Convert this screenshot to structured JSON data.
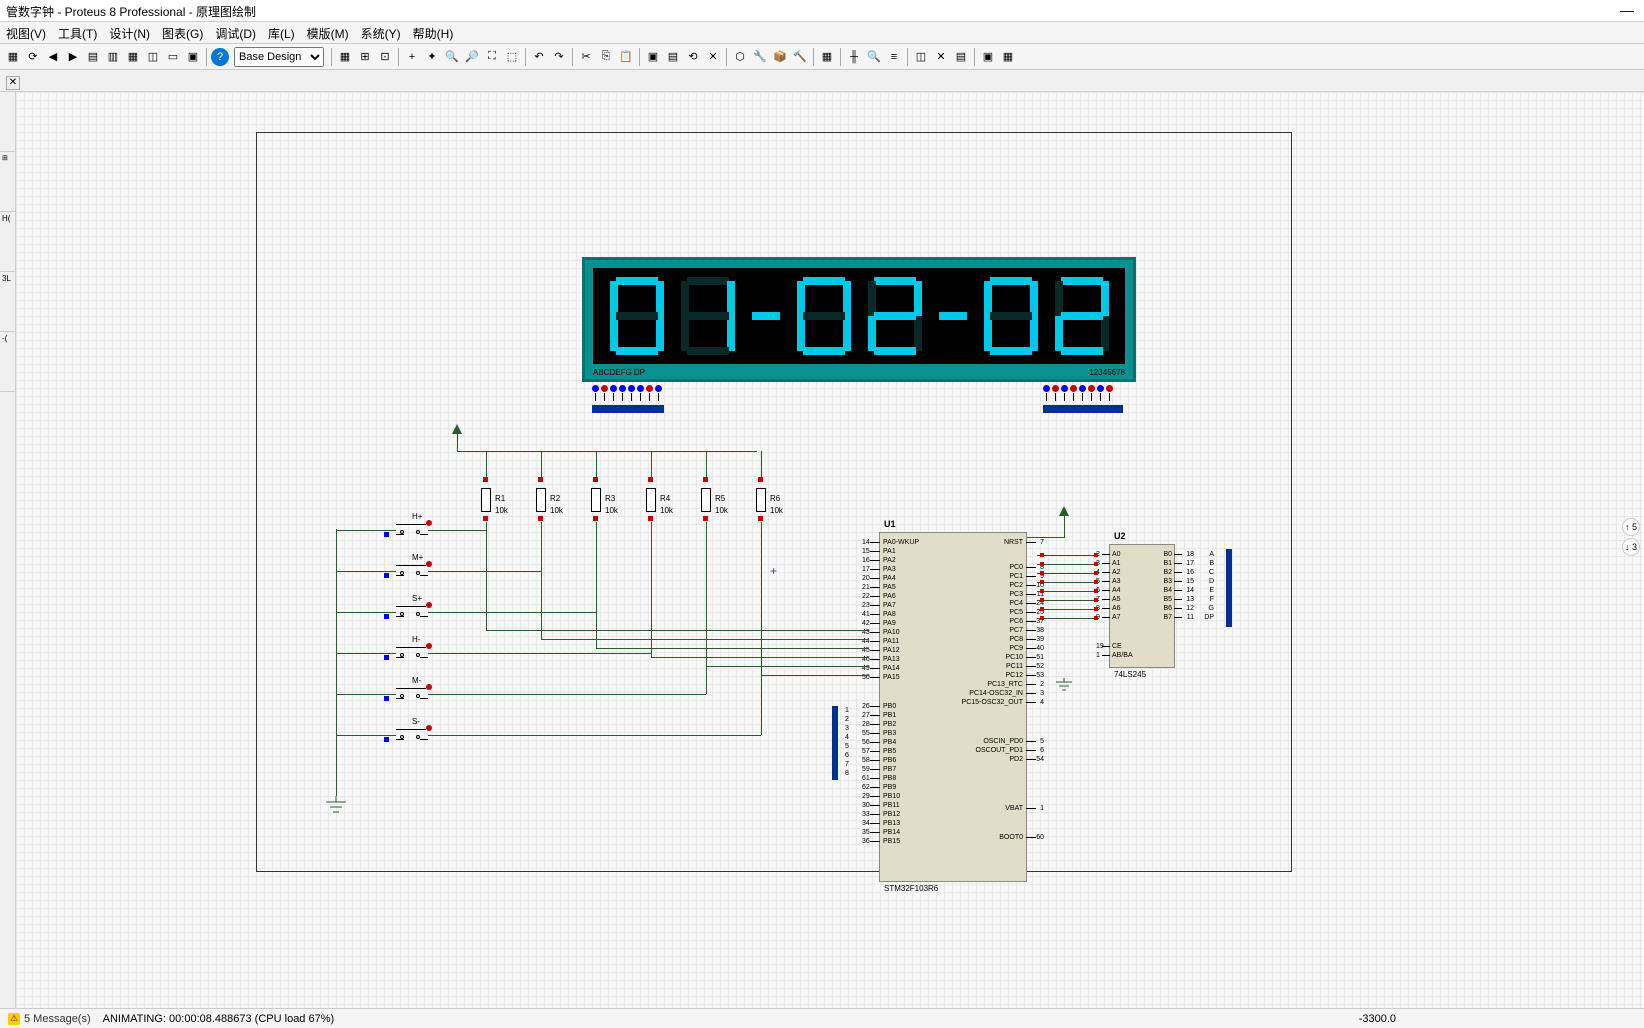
{
  "window": {
    "title": "管数字钟 - Proteus 8 Professional - 原理图绘制"
  },
  "menu": {
    "items": [
      "视图(V)",
      "工具(T)",
      "设计(N)",
      "图表(G)",
      "调试(D)",
      "库(L)",
      "模版(M)",
      "系统(Y)",
      "帮助(H)"
    ]
  },
  "toolbar": {
    "design_select": "Base Design"
  },
  "schematic": {
    "display": {
      "digits": [
        "0",
        "1",
        "-",
        "0",
        "2",
        "-",
        "0",
        "2"
      ],
      "pin_label_left": "ABCDEFG DP",
      "pin_label_right": "12345678"
    },
    "chips": {
      "u1": {
        "name": "U1",
        "part": "STM32F103R6",
        "left_pins": [
          {
            "num": "14",
            "lbl": "PA0-WKUP"
          },
          {
            "num": "15",
            "lbl": "PA1"
          },
          {
            "num": "16",
            "lbl": "PA2"
          },
          {
            "num": "17",
            "lbl": "PA3"
          },
          {
            "num": "20",
            "lbl": "PA4"
          },
          {
            "num": "21",
            "lbl": "PA5"
          },
          {
            "num": "22",
            "lbl": "PA6"
          },
          {
            "num": "23",
            "lbl": "PA7"
          },
          {
            "num": "41",
            "lbl": "PA8"
          },
          {
            "num": "42",
            "lbl": "PA9"
          },
          {
            "num": "43",
            "lbl": "PA10"
          },
          {
            "num": "44",
            "lbl": "PA11"
          },
          {
            "num": "45",
            "lbl": "PA12"
          },
          {
            "num": "46",
            "lbl": "PA13"
          },
          {
            "num": "49",
            "lbl": "PA14"
          },
          {
            "num": "50",
            "lbl": "PA15"
          },
          {
            "num": "26",
            "lbl": "PB0"
          },
          {
            "num": "27",
            "lbl": "PB1"
          },
          {
            "num": "28",
            "lbl": "PB2"
          },
          {
            "num": "55",
            "lbl": "PB3"
          },
          {
            "num": "56",
            "lbl": "PB4"
          },
          {
            "num": "57",
            "lbl": "PB5"
          },
          {
            "num": "58",
            "lbl": "PB6"
          },
          {
            "num": "59",
            "lbl": "PB7"
          },
          {
            "num": "61",
            "lbl": "PB8"
          },
          {
            "num": "62",
            "lbl": "PB9"
          },
          {
            "num": "29",
            "lbl": "PB10"
          },
          {
            "num": "30",
            "lbl": "PB11"
          },
          {
            "num": "33",
            "lbl": "PB12"
          },
          {
            "num": "34",
            "lbl": "PB13"
          },
          {
            "num": "35",
            "lbl": "PB14"
          },
          {
            "num": "36",
            "lbl": "PB15"
          }
        ],
        "right_pins": [
          {
            "num": "7",
            "lbl": "NRST"
          },
          {
            "num": "8",
            "lbl": "PC0"
          },
          {
            "num": "9",
            "lbl": "PC1"
          },
          {
            "num": "10",
            "lbl": "PC2"
          },
          {
            "num": "11",
            "lbl": "PC3"
          },
          {
            "num": "24",
            "lbl": "PC4"
          },
          {
            "num": "25",
            "lbl": "PC5"
          },
          {
            "num": "37",
            "lbl": "PC6"
          },
          {
            "num": "38",
            "lbl": "PC7"
          },
          {
            "num": "39",
            "lbl": "PC8"
          },
          {
            "num": "40",
            "lbl": "PC9"
          },
          {
            "num": "51",
            "lbl": "PC10"
          },
          {
            "num": "52",
            "lbl": "PC11"
          },
          {
            "num": "53",
            "lbl": "PC12"
          },
          {
            "num": "2",
            "lbl": "PC13_RTC"
          },
          {
            "num": "3",
            "lbl": "PC14-OSC32_IN"
          },
          {
            "num": "4",
            "lbl": "PC15-OSC32_OUT"
          },
          {
            "num": "5",
            "lbl": "OSCIN_PD0"
          },
          {
            "num": "6",
            "lbl": "OSCOUT_PD1"
          },
          {
            "num": "54",
            "lbl": "PD2"
          },
          {
            "num": "1",
            "lbl": "VBAT"
          },
          {
            "num": "60",
            "lbl": "BOOT0"
          }
        ],
        "bus_left_nums": [
          "1",
          "2",
          "3",
          "4",
          "5",
          "6",
          "7",
          "8"
        ]
      },
      "u2": {
        "name": "U2",
        "part": "74LS245",
        "left_pins": [
          {
            "num": "2",
            "lbl": "A0"
          },
          {
            "num": "3",
            "lbl": "A1"
          },
          {
            "num": "4",
            "lbl": "A2"
          },
          {
            "num": "5",
            "lbl": "A3"
          },
          {
            "num": "6",
            "lbl": "A4"
          },
          {
            "num": "7",
            "lbl": "A5"
          },
          {
            "num": "8",
            "lbl": "A6"
          },
          {
            "num": "9",
            "lbl": "A7"
          },
          {
            "num": "19",
            "lbl": "CE"
          },
          {
            "num": "1",
            "lbl": "AB/BA"
          }
        ],
        "right_pins": [
          {
            "num": "18",
            "lbl": "B0",
            "sig": "A"
          },
          {
            "num": "17",
            "lbl": "B1",
            "sig": "B"
          },
          {
            "num": "16",
            "lbl": "B2",
            "sig": "C"
          },
          {
            "num": "15",
            "lbl": "B3",
            "sig": "D"
          },
          {
            "num": "14",
            "lbl": "B4",
            "sig": "E"
          },
          {
            "num": "13",
            "lbl": "B5",
            "sig": "F"
          },
          {
            "num": "12",
            "lbl": "B6",
            "sig": "G"
          },
          {
            "num": "11",
            "lbl": "B7",
            "sig": "DP"
          }
        ]
      }
    },
    "resistors": [
      {
        "name": "R1",
        "val": "10k"
      },
      {
        "name": "R2",
        "val": "10k"
      },
      {
        "name": "R3",
        "val": "10k"
      },
      {
        "name": "R4",
        "val": "10k"
      },
      {
        "name": "R5",
        "val": "10k"
      },
      {
        "name": "R6",
        "val": "10k"
      }
    ],
    "buttons": [
      "H+",
      "M+",
      "S+",
      "H-",
      "M-",
      "S-"
    ]
  },
  "status": {
    "messages": "5 Message(s)",
    "anim": "ANIMATING: 00:00:08.488673 (CPU load 67%)",
    "coord": "-3300.0"
  },
  "carousel": {
    "up": "↑ 5",
    "down": "↓ 3"
  }
}
